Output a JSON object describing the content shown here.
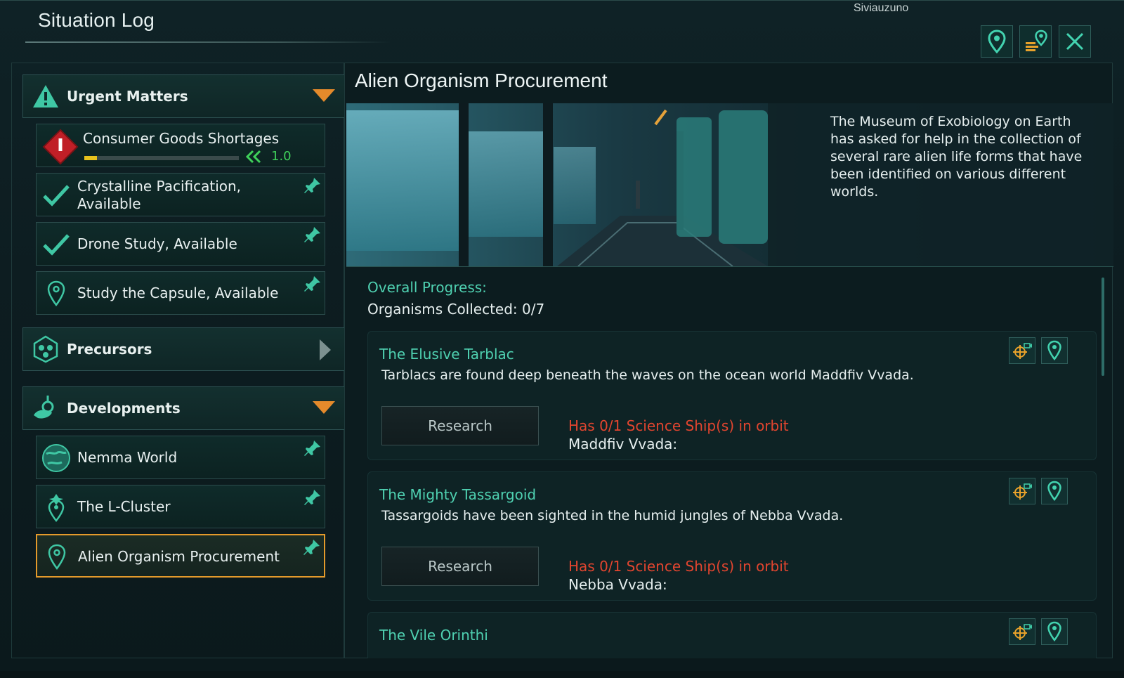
{
  "background": {
    "map_label": "Siviauzuno"
  },
  "window": {
    "title": "Situation Log"
  },
  "header_buttons": {
    "locate_icon": "location-pin-icon",
    "list_locate_icon": "list-location-icon",
    "close_icon": "close-icon"
  },
  "sidebar": {
    "groups": [
      {
        "label": "Urgent Matters",
        "icon": "warning-icon",
        "state": "expanded"
      },
      {
        "label": "Precursors",
        "icon": "precursor-icon",
        "state": "collapsed"
      },
      {
        "label": "Developments",
        "icon": "developments-icon",
        "state": "expanded"
      }
    ],
    "items": [
      {
        "label": "Consumer Goods Shortages",
        "icon": "alert-diamond-icon",
        "progress_value": "1.0",
        "progress_fraction": 0.08
      },
      {
        "label": "Crystalline Pacification, Available",
        "icon": "checkmark-icon"
      },
      {
        "label": "Drone Study, Available",
        "icon": "checkmark-icon"
      },
      {
        "label": "Study the Capsule, Available",
        "icon": "location-pin-icon"
      },
      {
        "label": "Nemma World",
        "icon": "planet-icon"
      },
      {
        "label": "The L-Cluster",
        "icon": "cluster-pin-icon"
      },
      {
        "label": "Alien Organism Procurement",
        "icon": "location-pin-icon",
        "selected": true
      }
    ]
  },
  "event": {
    "title": "Alien Organism Procurement",
    "description": "The Museum of Exobiology on Earth has asked for help in the collection of several rare alien life forms that have been identified on various different worlds.",
    "progress_label": "Overall Progress:",
    "progress_value": "Organisms Collected: 0/7",
    "cards": [
      {
        "title": "The Elusive Tarblac",
        "description": "Tarblacs are found deep beneath the waves on the ocean world Maddfiv Vvada.",
        "button": "Research",
        "requirement": "Has 0/1 Science Ship(s) in orbit",
        "location": "Maddfiv Vvada:"
      },
      {
        "title": "The Mighty Tassargoid",
        "description": "Tassargoids have been sighted in the humid jungles of Nebba Vvada.",
        "button": "Research",
        "requirement": "Has 0/1 Science Ship(s) in orbit",
        "location": "Nebba Vvada:"
      },
      {
        "title": "The Vile Orinthi"
      }
    ]
  },
  "colors": {
    "accent_teal": "#4fd1b1",
    "warning_red": "#e2452f",
    "selection_orange": "#e49a2b",
    "arrow_orange": "#e48a2b"
  }
}
